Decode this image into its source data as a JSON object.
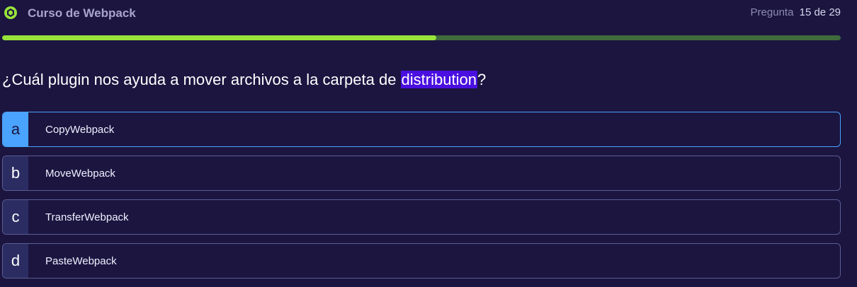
{
  "header": {
    "logo_icon": "webpack-logo-icon",
    "course_title": "Curso de Webpack",
    "counter_label": "Pregunta",
    "counter_value": "15 de 29"
  },
  "progress": {
    "fraction": 0.5175,
    "fill_color": "#98e33a",
    "track_color": "#3f6b3c"
  },
  "question": {
    "text_before": "¿Cuál plugin nos ayuda a mover archivos a la carpeta de ",
    "highlight": "distribution",
    "text_after": "?",
    "highlight_color": "#4a0fe0"
  },
  "options": [
    {
      "letter": "a",
      "label": "CopyWebpack",
      "selected": true
    },
    {
      "letter": "b",
      "label": "MoveWebpack",
      "selected": false
    },
    {
      "letter": "c",
      "label": "TransferWebpack",
      "selected": false
    },
    {
      "letter": "d",
      "label": "PasteWebpack",
      "selected": false
    }
  ],
  "colors": {
    "background": "#1b1540",
    "selected_accent": "#4aa3ff",
    "option_border": "#5c5d93",
    "letter_box": "#2a2c62"
  }
}
